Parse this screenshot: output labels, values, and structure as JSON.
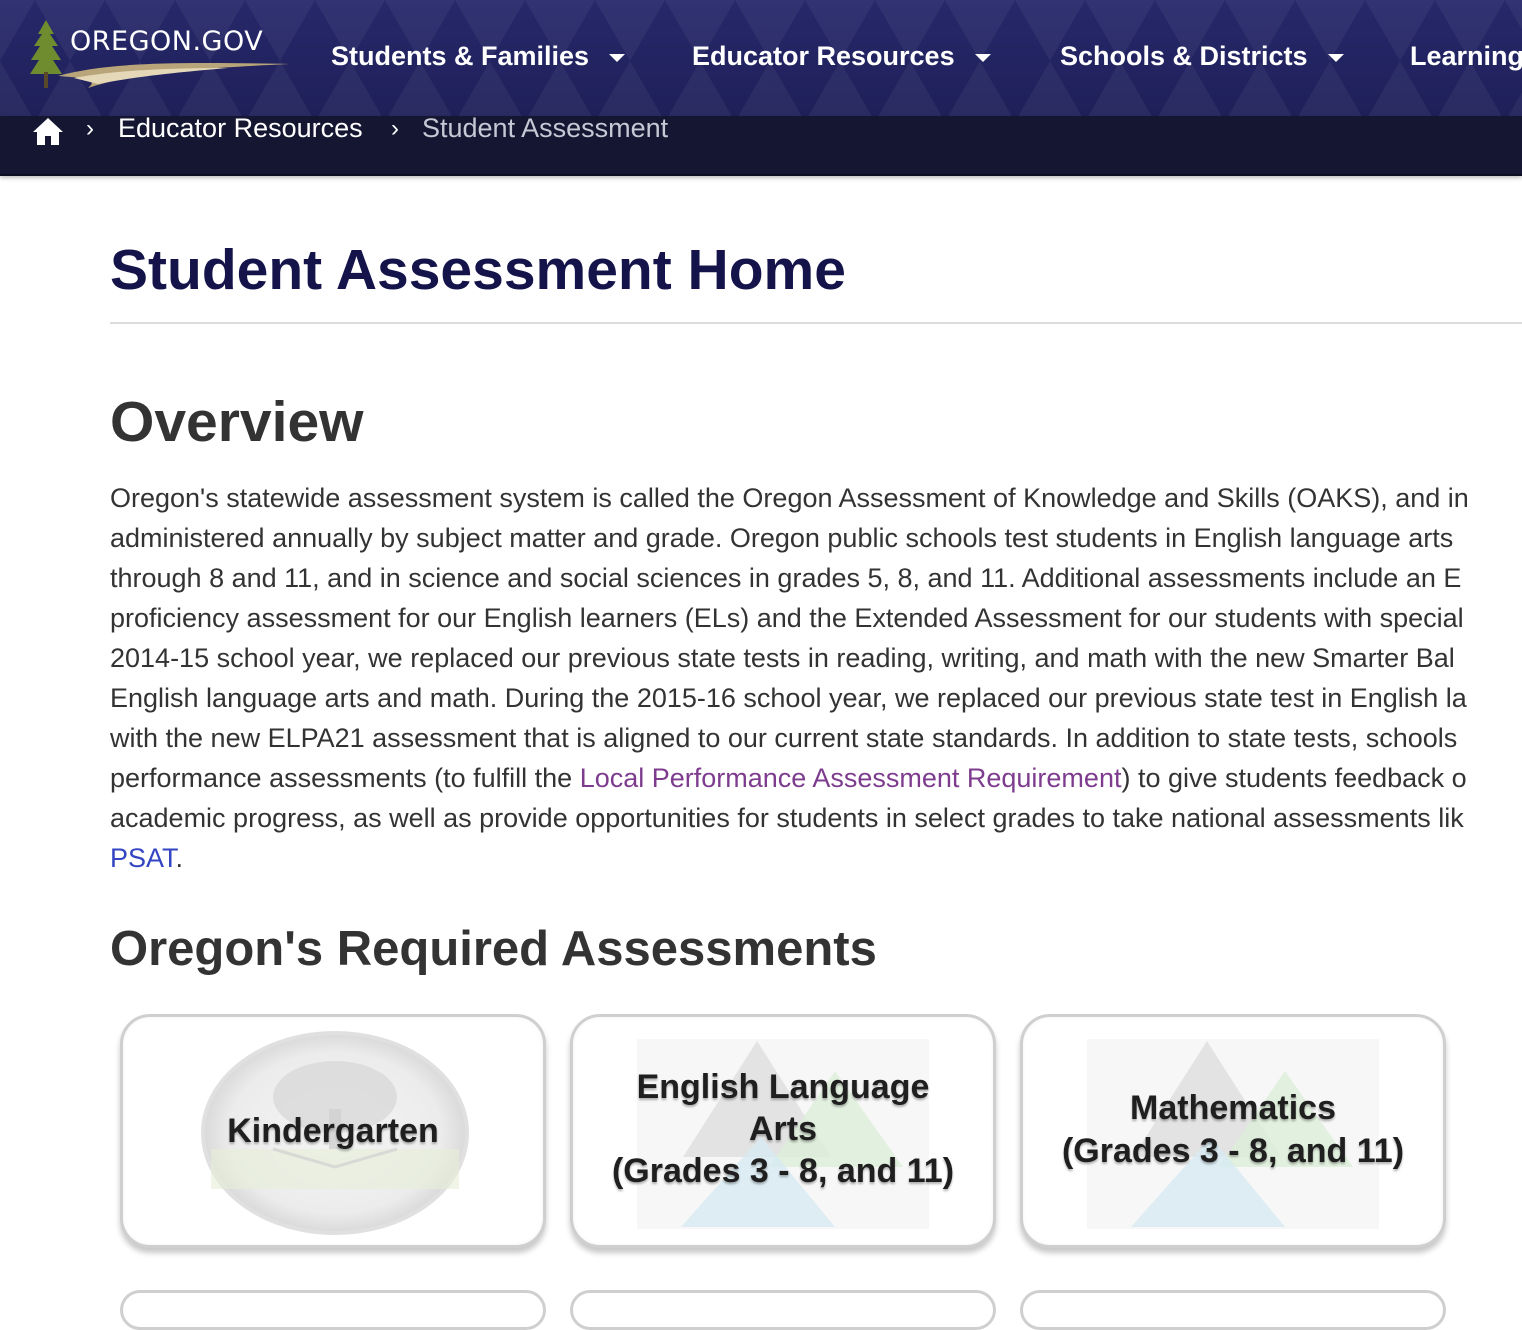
{
  "header": {
    "logo_text": "OREGON.GOV",
    "nav": [
      {
        "label": "Students & Families"
      },
      {
        "label": "Educator Resources"
      },
      {
        "label": "Schools & Districts"
      },
      {
        "label": "Learning"
      }
    ]
  },
  "breadcrumb": {
    "items": [
      {
        "label": "Educator Resources"
      },
      {
        "label": "Student Assessment"
      }
    ]
  },
  "page": {
    "title": "Student Assessment Home"
  },
  "overview": {
    "heading": "Overview",
    "lines": [
      "Oregon's statewide assessment system is called the Oregon Assessment of Knowledge and Skills (OAKS), and in",
      "administered annually by subject matter and grade. Oregon public schools test students in English language arts",
      "through 8 and 11, and in science and social sciences in grades 5, 8, and 11. Additional assessments include an E",
      "proficiency assessment for our English learners (ELs) and the Extended Assessment for our students with special",
      "2014-15 school year, we replaced our previous state tests in reading, writing, and math with the new Smarter Bal",
      "English language arts and math. During the 2015-16 school year, we replaced our previous state test in English la",
      "with the new ELPA21 assessment that is aligned to our current state standards. In addition to state tests, schools"
    ],
    "line8_before": "performance assessments (to fulfill the ",
    "line8_link": "Local Performance Assessment Requirement",
    "line8_after": ") to give students feedback o",
    "line9": "academic progress, as well as provide opportunities for students in select grades to take national assessments lik",
    "psat_link": "PSAT",
    "psat_after": "."
  },
  "required": {
    "heading": "Oregon's Required Assessments",
    "cards": [
      {
        "lines": [
          "Kindergarten"
        ]
      },
      {
        "lines": [
          "English Language",
          "Arts",
          "(Grades 3 - 8, and 11)"
        ]
      },
      {
        "lines": [
          "Mathematics",
          "(Grades 3 - 8, and 11)"
        ]
      }
    ]
  },
  "colors": {
    "nav_bg": "#22235e",
    "breadcrumb_bg": "#151732",
    "title": "#14134a",
    "body_text": "#333333",
    "link_visited": "#7e3c8f",
    "link": "#3345c2"
  },
  "icons": {
    "home": "home-icon",
    "caret": "caret-down-icon",
    "chevron": "chevron-right-icon"
  }
}
